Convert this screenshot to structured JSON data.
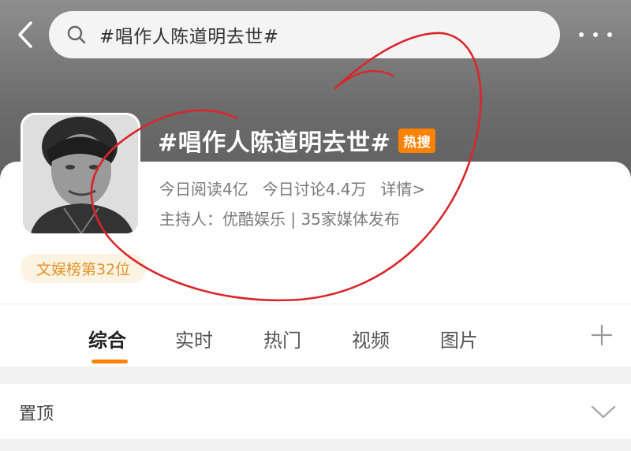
{
  "search": {
    "query": "#唱作人陈道明去世#"
  },
  "topic": {
    "title": "#唱作人陈道明去世#",
    "hot_badge": "热搜",
    "reads": "今日阅读4亿",
    "discussions": "今日讨论4.4万",
    "details_link": "详情>",
    "host_line": "主持人：优酷娱乐 | 35家媒体发布",
    "rank": "文娱榜第32位"
  },
  "tabs": [
    {
      "label": "综合",
      "active": true
    },
    {
      "label": "实时",
      "active": false
    },
    {
      "label": "热门",
      "active": false
    },
    {
      "label": "视频",
      "active": false
    },
    {
      "label": "图片",
      "active": false
    }
  ],
  "pinned": {
    "label": "置顶"
  },
  "colors": {
    "accent": "#ff8200",
    "rank_text": "#e0932a",
    "rank_bg": "#fdf3e2",
    "annotation": "#d9262b"
  },
  "icons": {
    "back": "back-arrow-icon",
    "search": "search-icon",
    "more": "more-icon",
    "add": "plus-icon",
    "expand": "chevron-down-icon"
  }
}
